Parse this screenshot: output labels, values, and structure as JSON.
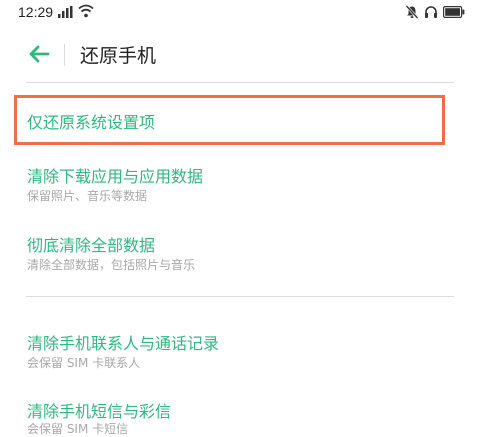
{
  "status_bar": {
    "time": "12:29",
    "icons": [
      "signal-icon",
      "wifi-icon",
      "mute-icon",
      "headphone-icon",
      "battery-icon"
    ]
  },
  "header": {
    "back_icon": "arrow-left-icon",
    "title": "还原手机"
  },
  "colors": {
    "accent_green": "#2dba7f",
    "highlight": "#ef6e45"
  },
  "menu": {
    "items": [
      {
        "title": "仅还原系统设置项",
        "subtitle": ""
      },
      {
        "title": "清除下载应用与应用数据",
        "subtitle": "保留照片、音乐等数据"
      },
      {
        "title": "彻底清除全部数据",
        "subtitle": "清除全部数据，包括照片与音乐"
      },
      {
        "title": "清除手机联系人与通话记录",
        "subtitle": "会保留 SIM 卡联系人"
      },
      {
        "title": "清除手机短信与彩信",
        "subtitle": "会保留 SIM 卡短信"
      }
    ]
  }
}
